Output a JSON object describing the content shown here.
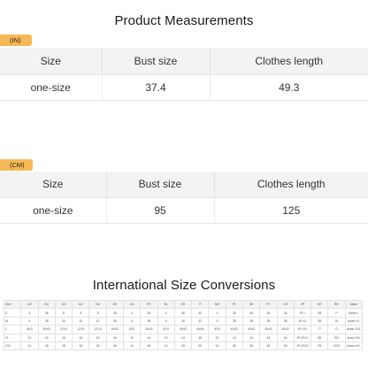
{
  "titles": {
    "product": "Product Measurements",
    "international": "International Size Conversions"
  },
  "colors": {
    "unit_tag": "#f7b955",
    "header_bg": "#f3f3f3"
  },
  "inches": {
    "unit_label": "(IN)",
    "headers": [
      "Size",
      "Bust size",
      "Clothes length"
    ],
    "row": [
      "one-size",
      "37.4",
      "49.3"
    ]
  },
  "centimeters": {
    "unit_label": "(CM)",
    "headers": [
      "Size",
      "Bust size",
      "Clothes length"
    ],
    "row": [
      "one-size",
      "95",
      "125"
    ]
  },
  "conversion": {
    "headers": [
      "Size",
      "US",
      "EU",
      "UK",
      "AU",
      "NZ",
      "DE",
      "CA",
      "FR",
      "NL",
      "ES",
      "IT",
      "MX",
      "PL",
      "SE",
      "PT",
      "CH",
      "JP",
      "KR",
      "BR",
      "Asian"
    ],
    "rows": [
      [
        "S",
        "4",
        "36",
        "8",
        "8",
        "8",
        "36",
        "4",
        "36",
        "4",
        "36",
        "40",
        "4",
        "36",
        "36",
        "36",
        "36",
        "JP-L",
        "55",
        "P",
        "Asian L"
      ],
      [
        "M",
        "6",
        "38",
        "10",
        "10",
        "10",
        "38",
        "6",
        "38",
        "6",
        "38",
        "42",
        "6",
        "38",
        "38",
        "38",
        "38",
        "JP-XL",
        "55",
        "M",
        "Asian XL"
      ],
      [
        "L",
        "8/10",
        "40/42",
        "12/14",
        "12/14",
        "12/14",
        "40/42",
        "8/10",
        "40/42",
        "8/10",
        "40/42",
        "44/46",
        "8/10",
        "40/42",
        "40/42",
        "40/42",
        "40/42",
        "JP-XXL",
        "77",
        "G",
        "Asian XXL"
      ],
      [
        "XL",
        "12",
        "44",
        "16",
        "16",
        "16",
        "44",
        "12",
        "44",
        "12",
        "44",
        "48",
        "12",
        "44",
        "44",
        "44",
        "44",
        "JP-3XXL",
        "88",
        "GG",
        "Asian 3XL"
      ],
      [
        "XXL",
        "14",
        "46",
        "18",
        "18",
        "18",
        "46",
        "14",
        "46",
        "14",
        "46",
        "50",
        "14",
        "46",
        "46",
        "46",
        "46",
        "JP-4XXL",
        "99",
        "XGG",
        "Asian 4XL"
      ]
    ]
  }
}
